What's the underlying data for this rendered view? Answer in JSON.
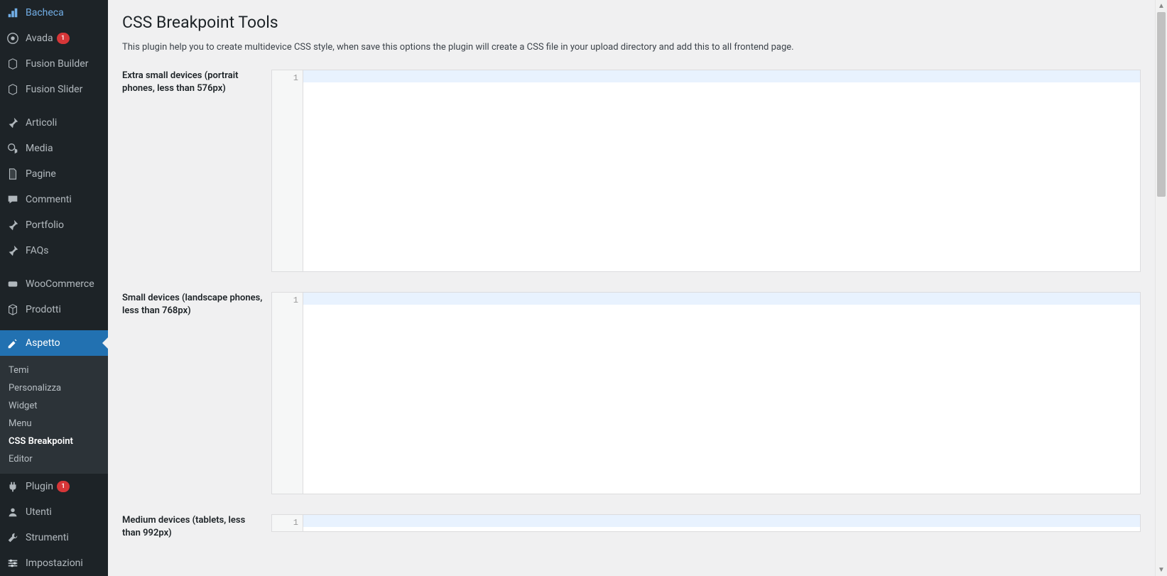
{
  "sidebar": {
    "items": [
      {
        "label": "Bacheca",
        "name": "sidebar-item-bacheca",
        "icon": "dashboard-icon"
      },
      {
        "label": "Avada",
        "name": "sidebar-item-avada",
        "icon": "avada-icon",
        "badge": "1"
      },
      {
        "label": "Fusion Builder",
        "name": "sidebar-item-fusion-builder",
        "icon": "fusion-icon"
      },
      {
        "label": "Fusion Slider",
        "name": "sidebar-item-fusion-slider",
        "icon": "fusion-icon"
      },
      {
        "label": "Articoli",
        "name": "sidebar-item-articoli",
        "icon": "pin-icon",
        "spacer_before": true
      },
      {
        "label": "Media",
        "name": "sidebar-item-media",
        "icon": "media-icon"
      },
      {
        "label": "Pagine",
        "name": "sidebar-item-pagine",
        "icon": "page-icon"
      },
      {
        "label": "Commenti",
        "name": "sidebar-item-commenti",
        "icon": "comment-icon"
      },
      {
        "label": "Portfolio",
        "name": "sidebar-item-portfolio",
        "icon": "pin-icon"
      },
      {
        "label": "FAQs",
        "name": "sidebar-item-faqs",
        "icon": "pin-icon"
      },
      {
        "label": "WooCommerce",
        "name": "sidebar-item-woocommerce",
        "icon": "woo-icon",
        "spacer_before": true
      },
      {
        "label": "Prodotti",
        "name": "sidebar-item-prodotti",
        "icon": "product-icon"
      },
      {
        "label": "Aspetto",
        "name": "sidebar-item-aspetto",
        "icon": "appearance-icon",
        "active": true,
        "spacer_before": true
      },
      {
        "label": "Plugin",
        "name": "sidebar-item-plugin",
        "icon": "plugin-icon",
        "badge": "1"
      },
      {
        "label": "Utenti",
        "name": "sidebar-item-utenti",
        "icon": "users-icon"
      },
      {
        "label": "Strumenti",
        "name": "sidebar-item-strumenti",
        "icon": "tools-icon"
      },
      {
        "label": "Impostazioni",
        "name": "sidebar-item-impostazioni",
        "icon": "settings-icon"
      }
    ],
    "submenu": [
      {
        "label": "Temi",
        "name": "submenu-item-temi"
      },
      {
        "label": "Personalizza",
        "name": "submenu-item-personalizza"
      },
      {
        "label": "Widget",
        "name": "submenu-item-widget"
      },
      {
        "label": "Menu",
        "name": "submenu-item-menu"
      },
      {
        "label": "CSS Breakpoint",
        "name": "submenu-item-css-breakpoint",
        "current": true
      },
      {
        "label": "Editor",
        "name": "submenu-item-editor"
      }
    ]
  },
  "main": {
    "title": "CSS Breakpoint Tools",
    "description": "This plugin help you to create multidevice CSS style, when save this options the plugin will create a CSS file in your upload directory and add this to all frontend page.",
    "breakpoints": [
      {
        "label": "Extra small devices (portrait phones, less than 576px)",
        "gutter_line": "1"
      },
      {
        "label": "Small devices (landscape phones, less than 768px)",
        "gutter_line": "1"
      },
      {
        "label": "Medium devices (tablets, less than 992px)",
        "gutter_line": "1"
      }
    ]
  }
}
